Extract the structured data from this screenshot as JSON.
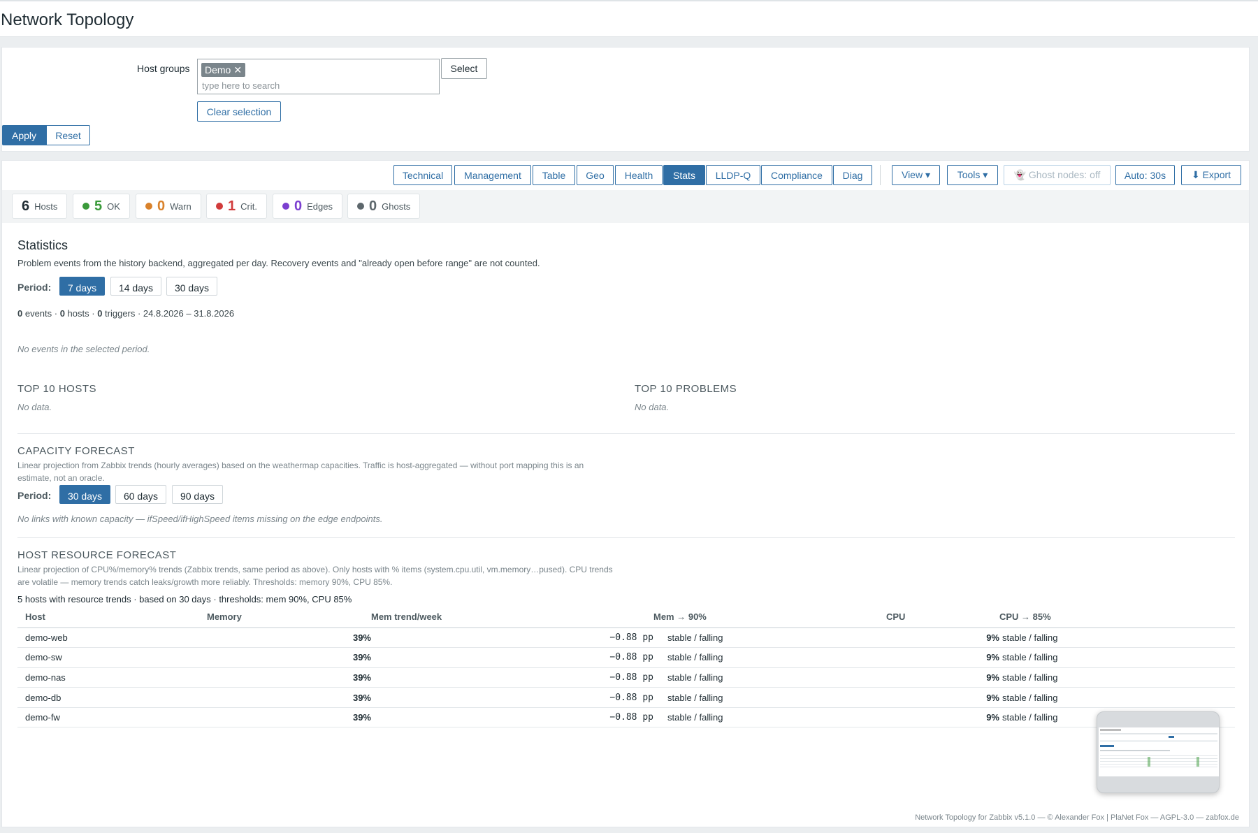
{
  "page": {
    "title": "Network Topology"
  },
  "filter": {
    "host_groups_label": "Host groups",
    "chip": "Demo",
    "chip_remove": "✕",
    "search_placeholder": "type here to search",
    "select_label": "Select",
    "clear_label": "Clear selection",
    "apply_label": "Apply",
    "reset_label": "Reset"
  },
  "toolbar": {
    "tabs": [
      "Technical",
      "Management",
      "Table",
      "Geo",
      "Health",
      "Stats",
      "LLDP-Q",
      "Compliance",
      "Diag"
    ],
    "active_tab": "Stats",
    "view_label": "View ▾",
    "tools_label": "Tools ▾",
    "ghost_label": "👻 Ghost nodes: off",
    "auto_label": "Auto: 30s",
    "export_label": "⬇ Export"
  },
  "counters": [
    {
      "num": "6",
      "label": "Hosts",
      "color": ""
    },
    {
      "num": "5",
      "label": "OK",
      "color": "#3a9a3a"
    },
    {
      "num": "0",
      "label": "Warn",
      "color": "#d9822b"
    },
    {
      "num": "1",
      "label": "Crit.",
      "color": "#d13b3b"
    },
    {
      "num": "0",
      "label": "Edges",
      "color": "#7b3fd0"
    },
    {
      "num": "0",
      "label": "Ghosts",
      "color": "#5d676c"
    }
  ],
  "stats": {
    "title": "Statistics",
    "description": "Problem events from the history backend, aggregated per day. Recovery events and \"already open before range\" are not counted.",
    "period_label": "Period:",
    "periods": [
      "7 days",
      "14 days",
      "30 days"
    ],
    "summary": {
      "events": "0",
      "events_word": " events · ",
      "hosts": "0",
      "hosts_word": " hosts · ",
      "triggers": "0",
      "triggers_word": " triggers · 24.8.2026 – 31.8.2026"
    },
    "no_events": "No events in the selected period.",
    "top_hosts_title": "TOP 10 HOSTS",
    "top_hosts_empty": "No data.",
    "top_problems_title": "TOP 10 PROBLEMS",
    "top_problems_empty": "No data."
  },
  "capacity": {
    "title": "CAPACITY FORECAST",
    "description": "Linear projection from Zabbix trends (hourly averages) based on the weathermap capacities. Traffic is host-aggregated — without port mapping this is an estimate, not an oracle.",
    "period_label": "Period:",
    "periods": [
      "30 days",
      "60 days",
      "90 days"
    ],
    "empty": "No links with known capacity — ifSpeed/ifHighSpeed items missing on the edge endpoints."
  },
  "resource": {
    "title": "HOST RESOURCE FORECAST",
    "description": "Linear projection of CPU%/memory% trends (Zabbix trends, same period as above). Only hosts with % items (system.cpu.util, vm.memory…pused). CPU trends are volatile — memory trends catch leaks/growth more reliably. Thresholds: memory 90%, CPU 85%.",
    "summary": "5 hosts with resource trends · based on 30 days · thresholds: mem 90%, CPU 85%",
    "columns": [
      "Host",
      "Memory",
      "Mem trend/week",
      "Mem → 90%",
      "CPU",
      "CPU → 85%"
    ],
    "rows": [
      {
        "host": "demo-web",
        "memory": "39%",
        "trend": "−0.88 pp",
        "mem_eta": "stable / falling",
        "cpu": "9%",
        "cpu_eta": "stable / falling"
      },
      {
        "host": "demo-sw",
        "memory": "39%",
        "trend": "−0.88 pp",
        "mem_eta": "stable / falling",
        "cpu": "9%",
        "cpu_eta": "stable / falling"
      },
      {
        "host": "demo-nas",
        "memory": "39%",
        "trend": "−0.88 pp",
        "mem_eta": "stable / falling",
        "cpu": "9%",
        "cpu_eta": "stable / falling"
      },
      {
        "host": "demo-db",
        "memory": "39%",
        "trend": "−0.88 pp",
        "mem_eta": "stable / falling",
        "cpu": "9%",
        "cpu_eta": "stable / falling"
      },
      {
        "host": "demo-fw",
        "memory": "39%",
        "trend": "−0.88 pp",
        "mem_eta": "stable / falling",
        "cpu": "9%",
        "cpu_eta": "stable / falling"
      }
    ]
  },
  "footer": "Network Topology for Zabbix v5.1.0 — © Alexander Fox | PlaNet Fox — AGPL-3.0 — zabfox.de",
  "colors": {
    "accent": "#2f6ea5",
    "ok": "#3a9a3a"
  }
}
